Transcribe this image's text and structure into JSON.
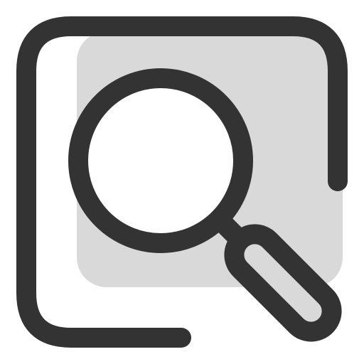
{
  "icon": {
    "name": "search-in-frame-icon",
    "colors": {
      "stroke": "#333333",
      "fill_panel": "#d9d9d9",
      "lens_fill": "#ffffff",
      "background": "#ffffff"
    }
  }
}
